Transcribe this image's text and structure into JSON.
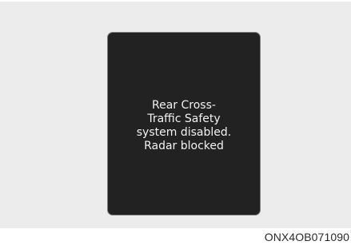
{
  "display": {
    "message": "Rear Cross-\nTraffic Safety\nsystem disabled.\nRadar blocked"
  },
  "figure": {
    "code": "ONX4OB071090"
  }
}
